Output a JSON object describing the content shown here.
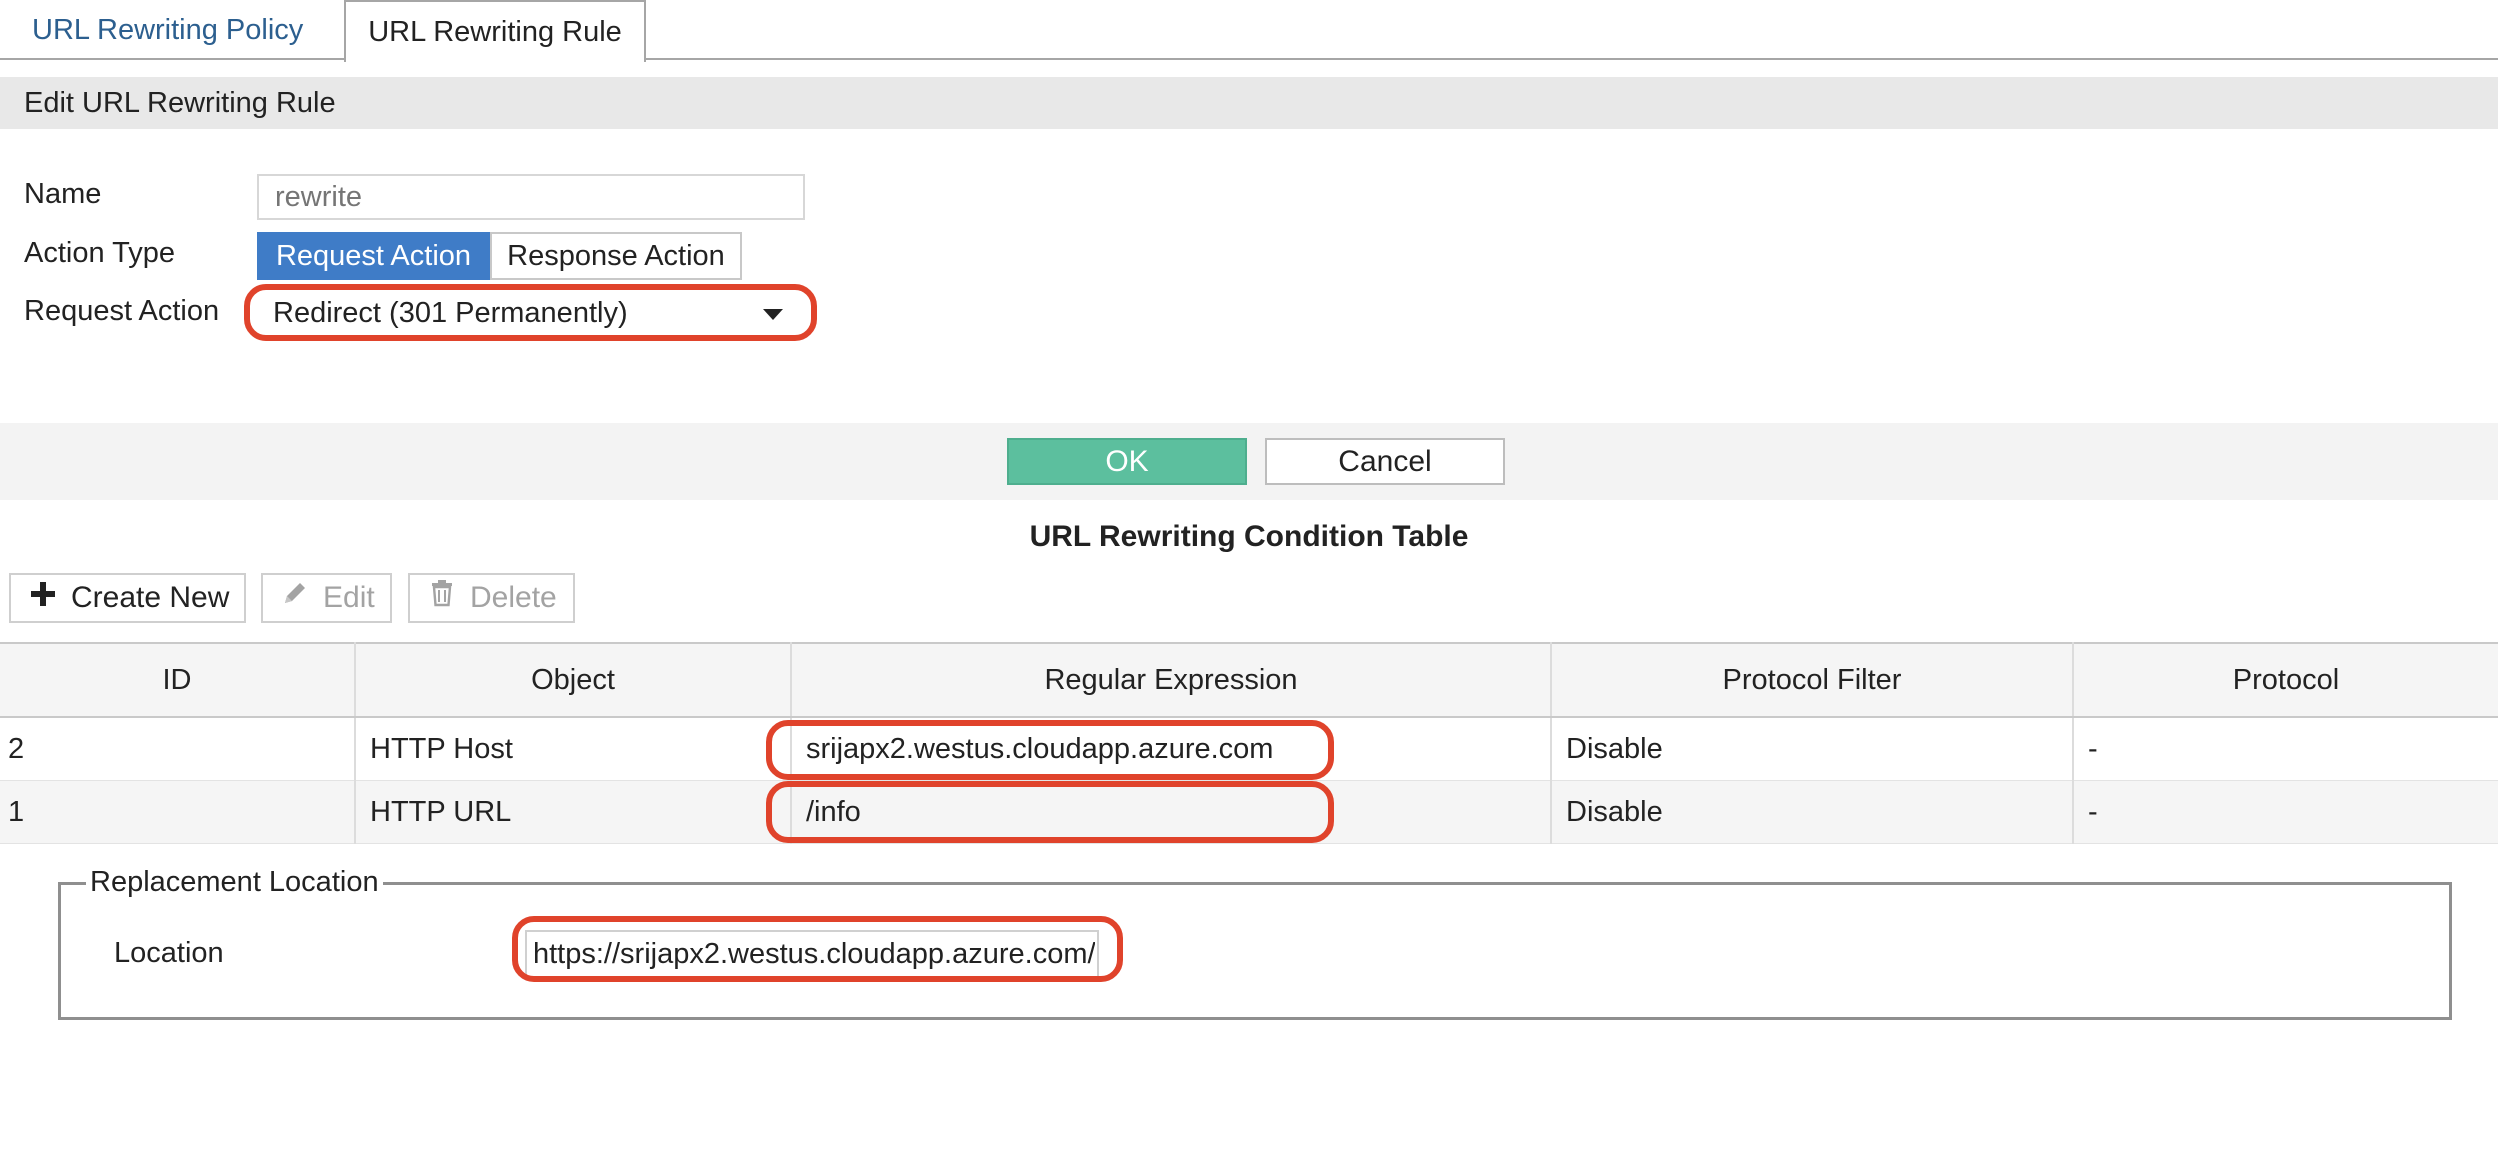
{
  "tabs": [
    {
      "label": "URL Rewriting Policy"
    },
    {
      "label": "URL Rewriting Rule"
    }
  ],
  "section": {
    "title": "Edit URL Rewriting Rule"
  },
  "form": {
    "name_label": "Name",
    "name_placeholder": "rewrite",
    "action_type_label": "Action Type",
    "action_type_options": [
      "Request Action",
      "Response Action"
    ],
    "request_action_label": "Request Action",
    "request_action_value": "Redirect (301 Permanently)"
  },
  "buttons": {
    "ok": "OK",
    "cancel": "Cancel"
  },
  "condition_table": {
    "title": "URL Rewriting Condition Table",
    "toolbar": {
      "create": "Create New",
      "edit": "Edit",
      "delete": "Delete"
    },
    "columns": [
      "ID",
      "Object",
      "Regular Expression",
      "Protocol Filter",
      "Protocol"
    ],
    "rows": [
      {
        "id": "2",
        "object": "HTTP Host",
        "regex": "srijapx2.westus.cloudapp.azure.com",
        "protocol_filter": "Disable",
        "protocol": "-"
      },
      {
        "id": "1",
        "object": "HTTP URL",
        "regex": "/info",
        "protocol_filter": "Disable",
        "protocol": "-"
      }
    ]
  },
  "replacement": {
    "legend": "Replacement Location",
    "location_label": "Location",
    "location_value": "https://srijapx2.westus.cloudapp.azure.com/"
  },
  "colors": {
    "tab_link": "#2c5f8f",
    "selected_blue": "#3f7cc7",
    "ok_green": "#5cbf9e",
    "highlight_red": "#e0432b"
  }
}
